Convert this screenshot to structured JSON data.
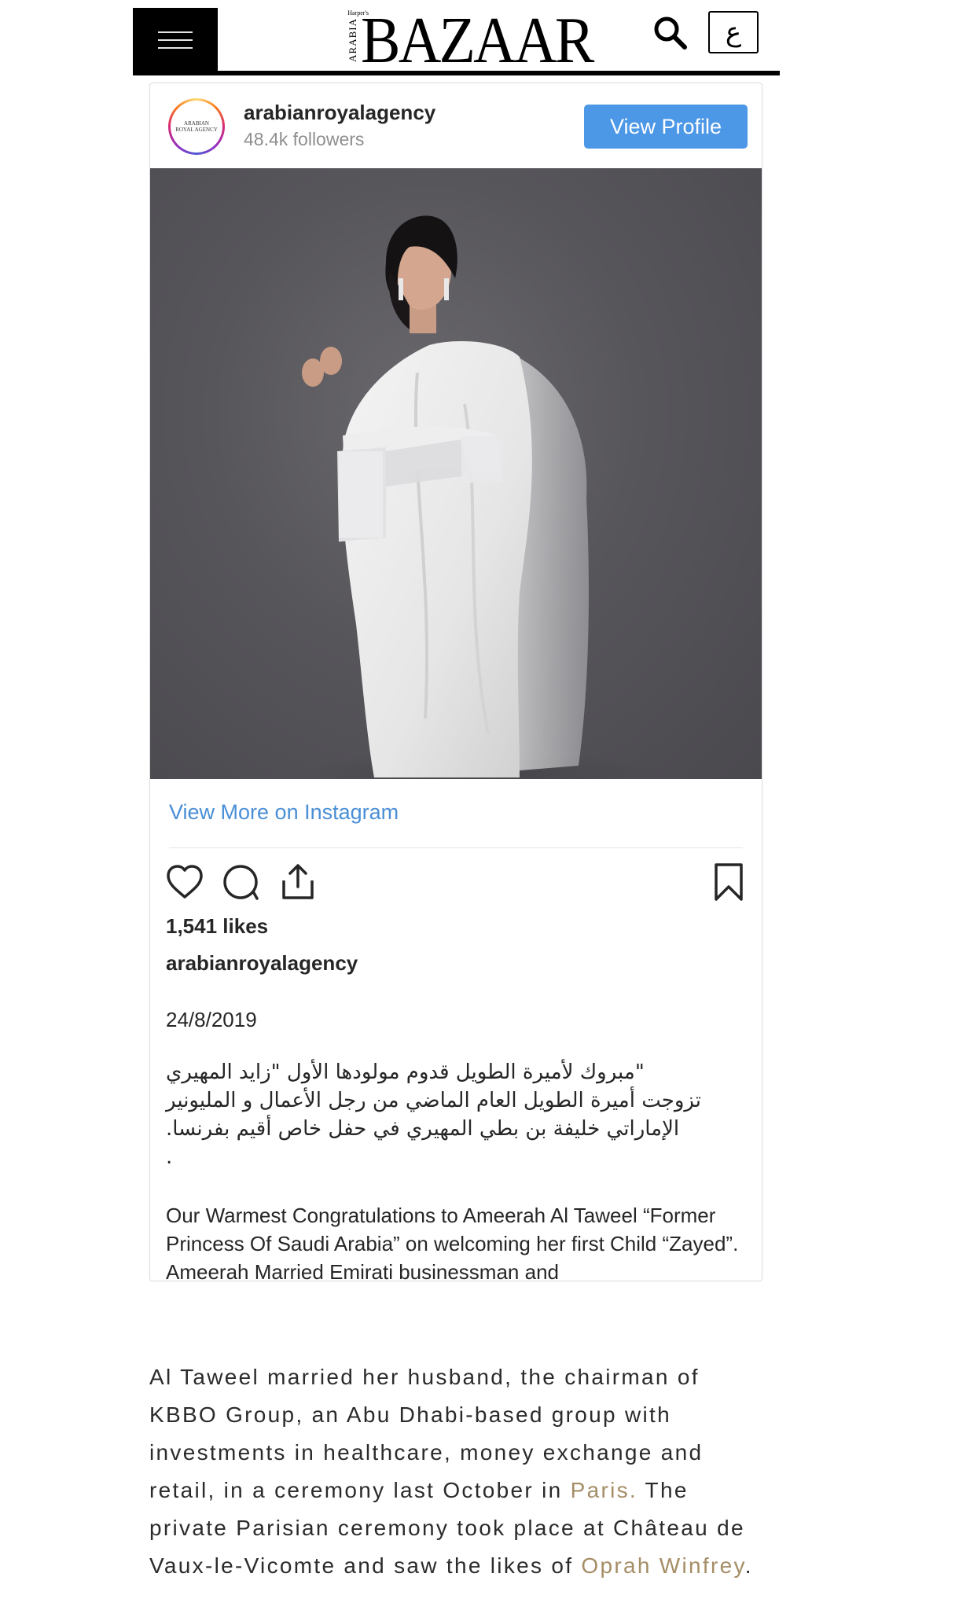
{
  "header": {
    "menu_label": "Menu",
    "logo_small_top": "Harper's",
    "logo_side": "ARABIA",
    "logo_word": "BAZAAR",
    "language_toggle": "ع"
  },
  "instagram": {
    "avatar_text_line1": "ARABIAN",
    "avatar_text_line2": "ROYAL AGENCY",
    "username": "arabianroyalagency",
    "followers": "48.4k followers",
    "view_profile_label": "View Profile",
    "view_more_label": "View More on Instagram",
    "likes": "1,541 likes",
    "author": "arabianroyalagency",
    "date": "24/8/2019",
    "caption_arabic": [
      "\"مبروك لأميرة الطويل قدوم مولودها الأول \"زايد المهيري",
      "تزوجت أميرة الطويل العام الماضي من رجل الأعمال و المليونير",
      "الإماراتي خليفة بن بطي المهيري في حفل خاص أقيم بفرنسا.",
      "."
    ],
    "caption_english": "Our Warmest Congratulations to Ameerah Al Taweel “Former Princess Of Saudi Arabia” on welcoming her first Child “Zayed”. Ameerah Married Emirati businessman and",
    "accent_color": "#4c97e6"
  },
  "article": {
    "part1": "Al Taweel  married her husband, the chairman of KBBO Group, an Abu Dhabi-based group with investments in healthcare, money exchange and retail, in a ceremony last October in ",
    "link1": "Paris.",
    "part2": " The private Parisian ceremony took place at Château de Vaux-le-Vicomte and saw the likes of ",
    "link2": "Oprah Winfrey",
    "part3": ".",
    "link_color": "#a58d66"
  }
}
